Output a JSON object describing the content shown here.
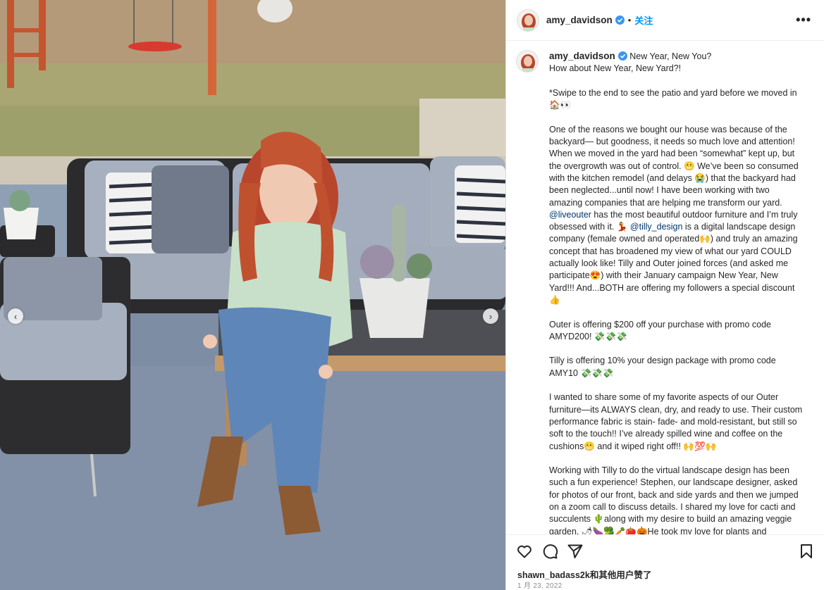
{
  "post": {
    "username": "amy_davidson",
    "follow_label": "关注",
    "more_label": "•••",
    "separator": "•",
    "caption_first": "New Year, New You?",
    "caption_lines": [
      "How about New Year, New Yard?!",
      "",
      "*Swipe to the end to see the patio and yard before we moved in",
      "🏠👀",
      "",
      "One of the reasons we bought our house was because of the",
      "backyard— but goodness, it needs so much love and attention!",
      "When we moved in the yard had been “somewhat” kept up, but",
      "the overgrowth was out of control. 😬 We’ve been so consumed",
      "with the kitchen remodel (and delays 😭) that the backyard had",
      "been neglected...until now! I have been working with two",
      "amazing companies that are helping me transform our yard.",
      "@liveouter has the most beautiful outdoor furniture and I’m truly",
      "obsessed with it. 💃 @tilly_design is a digital landscape design",
      "company (female owned and operated🙌) and truly an amazing",
      "concept that has broadened my view of what our yard COULD",
      "actually look like! Tilly and Outer joined forces (and asked me",
      "participate😍) with their January campaign New Year, New",
      "Yard!!! And...BOTH are offering my followers a special discount",
      "👍",
      "",
      "Outer is offering $200 off your purchase with promo code",
      "AMYD200! 💸💸💸",
      "",
      "Tilly is offering 10% your design package with promo code",
      "AMY10 💸💸💸",
      "",
      "I wanted to share some of my favorite aspects of our Outer",
      "furniture—its ALWAYS clean, dry, and ready to use. Their custom",
      "performance fabric is stain- fade- and mold-resistant, but still so",
      "soft to the touch!! I’ve already spilled wine and coffee on the",
      "cushions😬 and it wiped right off!! 🙌💯🙌",
      "",
      "Working with Tilly to do the virtual landscape design has been",
      "such a fun experience! Stephen, our landscape designer, asked",
      "for photos of our front, back and side yards and then we jumped",
      "on a zoom call to discuss details. I shared my love for cacti and",
      "succulents 🌵along with my desire to build an amazing veggie",
      "garden. 🌶🍆🥦🥕🍅🎃He took my love for plants and"
    ],
    "likes_text": "shawn_badass2k和其他用户赞了",
    "date_text": "1 月 23, 2022"
  },
  "nav": {
    "prev": "‹",
    "next": "›"
  },
  "icons": [
    "heart-icon",
    "comment-icon",
    "share-icon",
    "bookmark-icon",
    "verified-icon"
  ],
  "colors": {
    "follow": "#0095f6",
    "verified": "#3897f0",
    "mention": "#00376b"
  }
}
